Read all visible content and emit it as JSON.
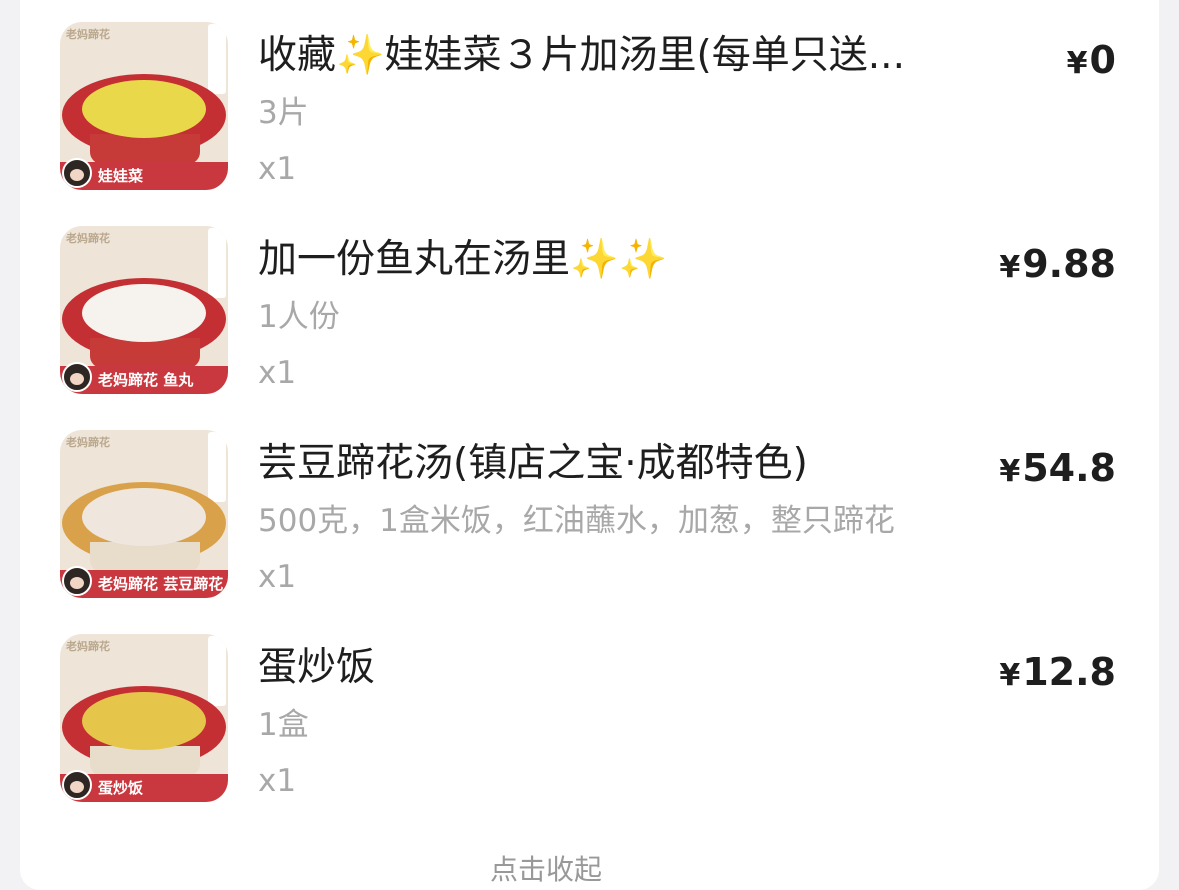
{
  "order": {
    "items": [
      {
        "name": "收藏✨娃娃菜３片加汤里(每单只送...",
        "spec": "3片",
        "qty": "x1",
        "currency": "¥",
        "price": "0",
        "thumb": {
          "banner": "娃娃菜",
          "bowl_color": "#c42f33",
          "food_color": "#e9d84a"
        }
      },
      {
        "name": "加一份鱼丸在汤里✨✨",
        "spec": "1人份",
        "qty": "x1",
        "currency": "¥",
        "price": "9.88",
        "thumb": {
          "banner": "老妈蹄花 鱼丸",
          "bowl_color": "#c42f33",
          "food_color": "#f6f3ee"
        }
      },
      {
        "name": "芸豆蹄花汤(镇店之宝·成都特色)",
        "spec": "500克，1盒米饭，红油蘸水，加葱，整只蹄花",
        "qty": "x1",
        "currency": "¥",
        "price": "54.8",
        "thumb": {
          "banner": "老妈蹄花 芸豆蹄花",
          "bowl_color": "#d9a24a",
          "food_color": "#efe7de"
        }
      },
      {
        "name": "蛋炒饭",
        "spec": "1盒",
        "qty": "x1",
        "currency": "¥",
        "price": "12.8",
        "thumb": {
          "banner": "蛋炒饭",
          "bowl_color": "#c42f33",
          "food_color": "#e6c64a"
        }
      }
    ],
    "footer_partial": "点击收起"
  }
}
